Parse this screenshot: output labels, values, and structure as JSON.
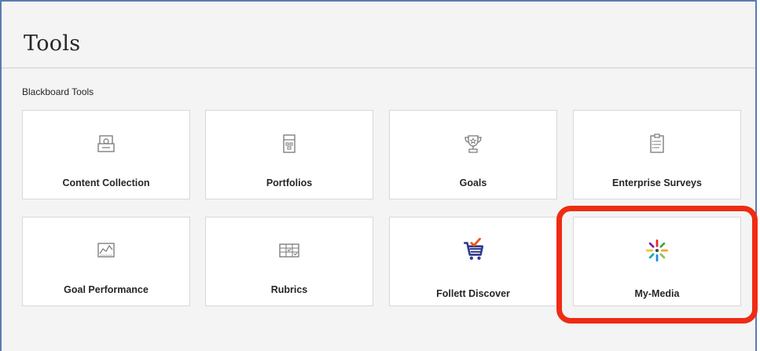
{
  "page": {
    "title": "Tools"
  },
  "section": {
    "label": "Blackboard Tools"
  },
  "tools": [
    {
      "label": "Content Collection",
      "icon": "content-collection-icon"
    },
    {
      "label": "Portfolios",
      "icon": "portfolios-icon"
    },
    {
      "label": "Goals",
      "icon": "goals-trophy-icon"
    },
    {
      "label": "Enterprise Surveys",
      "icon": "survey-clipboard-icon"
    },
    {
      "label": "Goal Performance",
      "icon": "goal-performance-chart-icon"
    },
    {
      "label": "Rubrics",
      "icon": "rubrics-grid-icon"
    },
    {
      "label": "Follett Discover",
      "icon": "follett-cart-icon"
    },
    {
      "label": "My-Media",
      "icon": "kaltura-starburst-icon"
    }
  ],
  "colors": {
    "highlight": "#ef2b14",
    "frame": "#5b7bb0",
    "follett_cart": "#2e3a8c",
    "follett_check": "#e8541c"
  }
}
